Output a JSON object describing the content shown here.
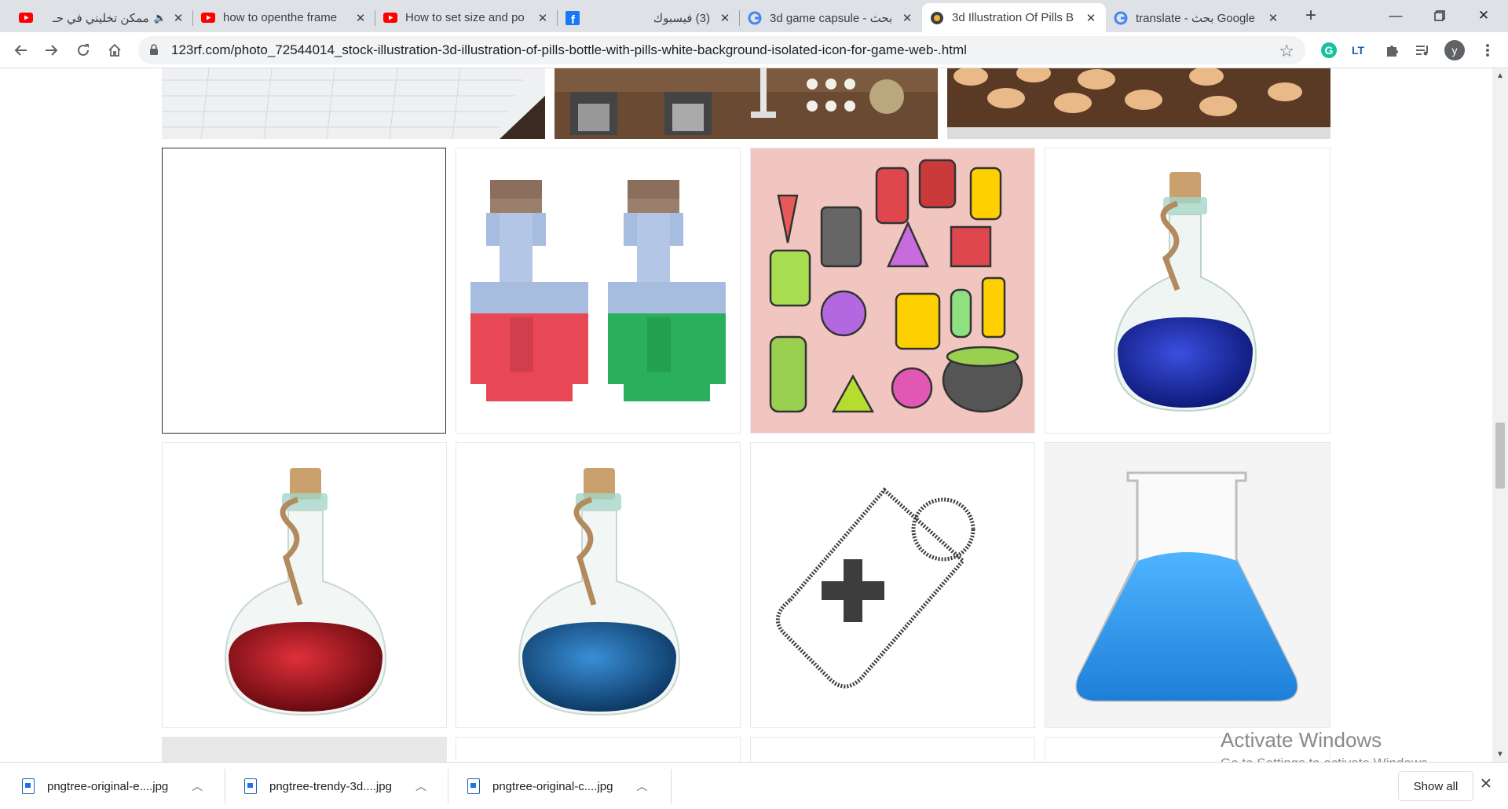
{
  "browser": {
    "tabs": [
      {
        "title": "ممكن تخليني في حـ",
        "icon": "youtube-icon",
        "muted_icon": "speaker-icon"
      },
      {
        "title": "how to openthe frame",
        "icon": "youtube-icon"
      },
      {
        "title": "How to set size and po",
        "icon": "youtube-icon"
      },
      {
        "title": "(3) فيسبوك",
        "icon": "facebook-icon"
      },
      {
        "title": "3d game capsule - بحث",
        "icon": "google-icon"
      },
      {
        "title": "3d Illustration Of Pills B",
        "icon": "123rf-icon",
        "active": true
      },
      {
        "title": "translate - بحث Google",
        "icon": "google-icon"
      }
    ],
    "new_tab_label": "+",
    "address": "123rf.com/photo_72544014_stock-illustration-3d-illustration-of-pills-bottle-with-pills-white-background-isolated-icon-for-game-web-.html",
    "profile_initial": "y",
    "colors": {
      "tabbar": "#dee1e6",
      "accent": "#1a73e8",
      "youtube": "#ff0000",
      "facebook": "#1877f2"
    }
  },
  "gallery": {
    "images": [
      "graph-paper-photo",
      "pills-and-syringe-photo",
      "round-pills-on-wood-photo",
      "blank-image",
      "pixel-potion-bottles",
      "doodle-poison-bottles",
      "blue-potion-bottle",
      "red-potion-bottle",
      "light-blue-potion-bottle",
      "crowd-medicine-tag",
      "blue-chemistry-flask"
    ]
  },
  "downloads": {
    "items": [
      {
        "name": "pngtree-original-e....jpg"
      },
      {
        "name": "pngtree-trendy-3d....jpg"
      },
      {
        "name": "pngtree-original-c....jpg"
      }
    ],
    "show_all_label": "Show all",
    "close_label": "✕"
  },
  "watermark": {
    "title": "Activate Windows",
    "subtitle": "Go to Settings to activate Windows."
  }
}
